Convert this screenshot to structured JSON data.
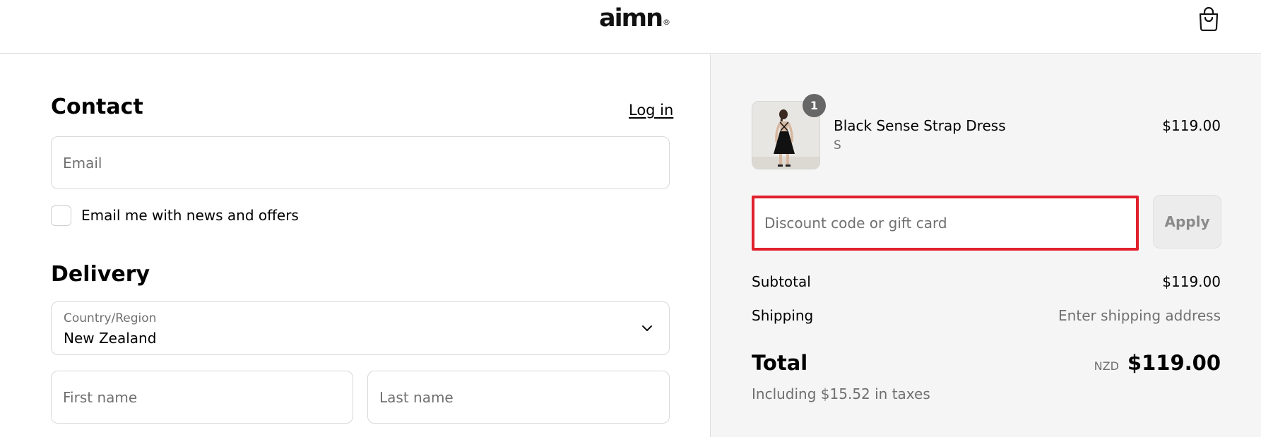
{
  "header": {
    "logo_text": "aimn",
    "logo_mark": "®",
    "cart_icon": "shopping-bag-icon"
  },
  "contact": {
    "title": "Contact",
    "login_label": "Log in",
    "email_placeholder": "Email",
    "newsletter_label": "Email me with news and offers",
    "newsletter_checked": false
  },
  "delivery": {
    "title": "Delivery",
    "country_label": "Country/Region",
    "country_value": "New Zealand",
    "chevron_icon": "chevron-down-icon",
    "first_name_placeholder": "First name",
    "last_name_placeholder": "Last name"
  },
  "summary": {
    "item": {
      "quantity": "1",
      "name": "Black Sense Strap Dress",
      "variant": "S",
      "price": "$119.00"
    },
    "discount": {
      "placeholder": "Discount code or gift card",
      "apply_label": "Apply",
      "highlight_color": "#e0202d"
    },
    "subtotal_label": "Subtotal",
    "subtotal_value": "$119.00",
    "shipping_label": "Shipping",
    "shipping_value": "Enter shipping address",
    "total_label": "Total",
    "currency": "NZD",
    "total_value": "$119.00",
    "taxes_line": "Including $15.52 in taxes"
  }
}
